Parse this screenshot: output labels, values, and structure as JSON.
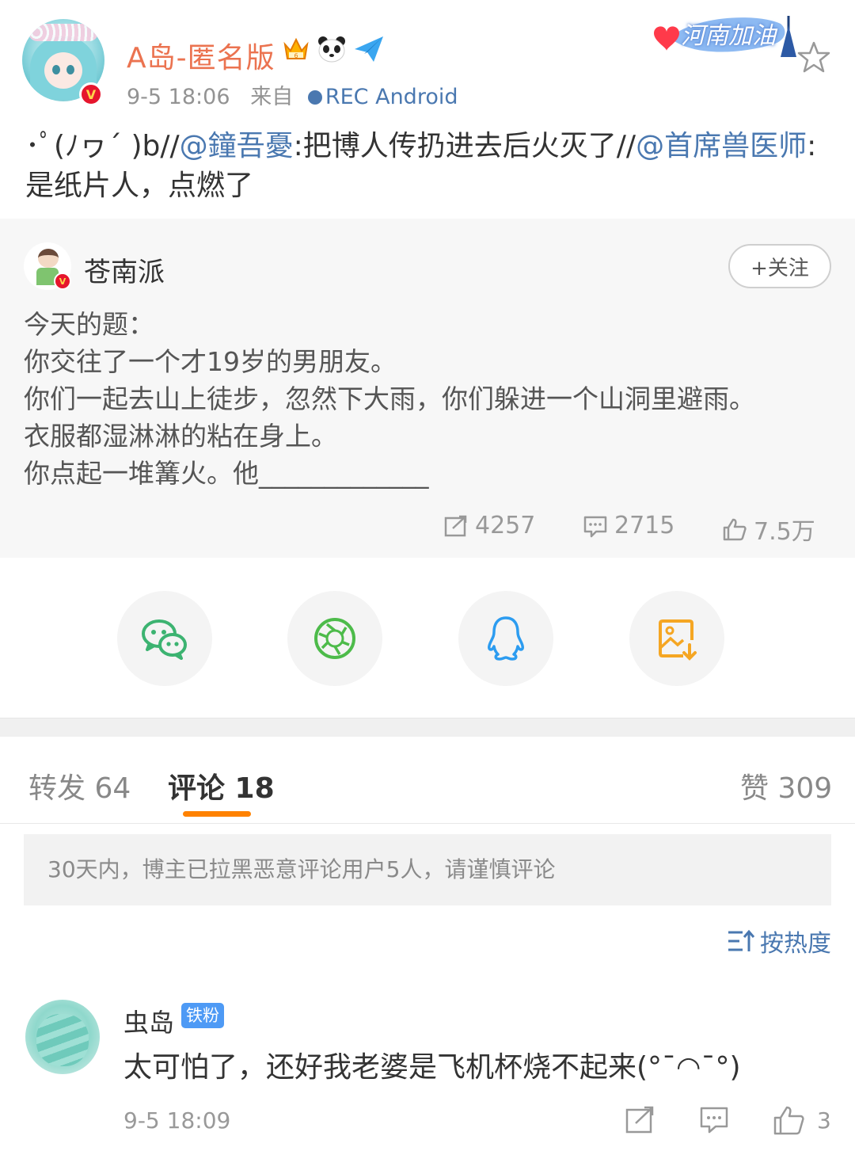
{
  "post": {
    "username": "A岛-匿名版",
    "time": "9-5 18:06",
    "from_label": "来自",
    "source": "REC  Android",
    "badge_text": "河南加油"
  },
  "repost_text": {
    "prefix": "･ﾟ(ﾉヮ´ )b//",
    "mention1": "@鐘吾憂",
    "text1": ":把博人传扔进去后火灭了//",
    "mention2": "@首席兽医师",
    "text2": ":是纸片人，点燃了"
  },
  "original": {
    "author": "苍南派",
    "follow_label": "+关注",
    "lines": [
      "今天的题：",
      "你交往了一个才19岁的男朋友。",
      "你们一起去山上徒步，忽然下大雨，你们躲进一个山洞里避雨。",
      "衣服都湿淋淋的粘在身上。",
      "你点起一堆篝火。他_____________"
    ],
    "reposts": "4257",
    "comments": "2715",
    "likes": "7.5万"
  },
  "share": {
    "items": [
      "wechat-icon",
      "moments-icon",
      "qq-icon",
      "save-image-icon"
    ]
  },
  "tabs": {
    "repost": "转发 64",
    "comment": "评论 18",
    "like": "赞 309"
  },
  "notice": "30天内，博主已拉黑恶意评论用户5人，请谨慎评论",
  "sort_label": "按热度",
  "comment": {
    "name": "虫岛",
    "tag": "铁粉",
    "text": "太可怕了，还好我老婆是飞机杯烧不起来(°ˉ◠ˉ°)",
    "time": "9-5 18:09",
    "like_count": "3"
  },
  "colors": {
    "username": "#eb7350",
    "link": "#4a78b0",
    "tab_accent": "#ff8200",
    "vip_red": "#e6162d",
    "tag_blue": "#4e9af5"
  }
}
